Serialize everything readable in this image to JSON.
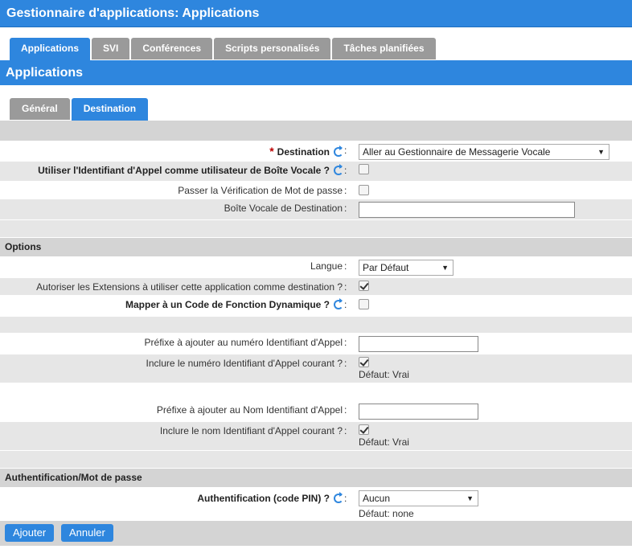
{
  "window": {
    "title": "Gestionnaire d'applications:  Applications"
  },
  "tabs": [
    {
      "label": "Applications",
      "active": true
    },
    {
      "label": "SVI",
      "active": false
    },
    {
      "label": "Conférences",
      "active": false
    },
    {
      "label": "Scripts personalisés",
      "active": false
    },
    {
      "label": "Tâches planifiées",
      "active": false
    }
  ],
  "subheader": {
    "title": "Applications"
  },
  "subtabs": [
    {
      "label": "Général",
      "active": false
    },
    {
      "label": "Destination",
      "active": true
    }
  ],
  "form": {
    "destination": {
      "label": "Destination",
      "required_mark": "*",
      "value": "Aller au Gestionnaire de Messagerie Vocale"
    },
    "use_callerid": {
      "label": "Utiliser l'Identifiant d'Appel comme utilisateur de Boîte Vocale ?",
      "checked": false
    },
    "skip_password": {
      "label": "Passer la Vérification de Mot de passe",
      "checked": false
    },
    "dest_mailbox": {
      "label": "Boîte Vocale de Destination",
      "value": ""
    },
    "options_section": "Options",
    "language": {
      "label": "Langue",
      "value": "Par Défaut"
    },
    "allow_ext": {
      "label": "Autoriser les Extensions à utiliser cette application comme destination ?",
      "checked": true
    },
    "dynamic_feature": {
      "label": "Mapper à un Code de Fonction Dynamique ?",
      "checked": false
    },
    "cid_num_prefix": {
      "label": "Préfixe à ajouter au numéro Identifiant d'Appel",
      "value": ""
    },
    "include_cid_num": {
      "label": "Inclure le numéro Identifiant d'Appel courant ?",
      "checked": true,
      "hint": "Défaut: Vrai"
    },
    "cid_name_prefix": {
      "label": "Préfixe à ajouter au Nom Identifiant d'Appel",
      "value": ""
    },
    "include_cid_name": {
      "label": "Inclure le nom Identifiant d'Appel courant ?",
      "checked": true,
      "hint": "Défaut: Vrai"
    },
    "auth_section": "Authentification/Mot de passe",
    "auth_pin": {
      "label": "Authentification (code PIN) ?",
      "value": "Aucun",
      "hint": "Défaut: none"
    }
  },
  "colon": ":",
  "buttons": {
    "add": "Ajouter",
    "cancel": "Annuler"
  }
}
